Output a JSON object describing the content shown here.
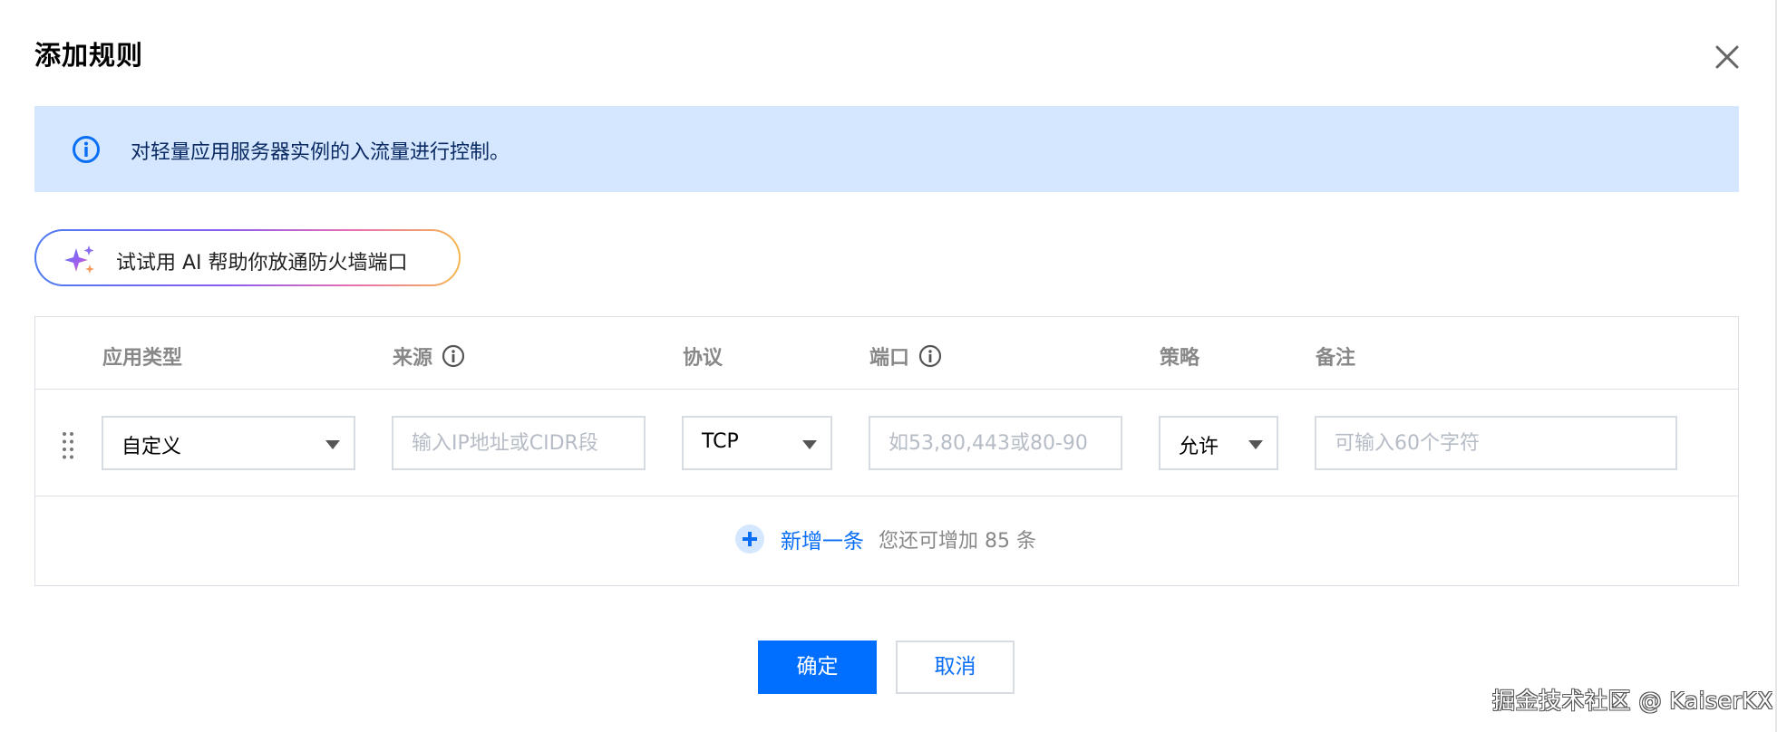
{
  "dialog": {
    "title": "添加规则",
    "close_icon": "close-icon"
  },
  "info": {
    "icon": "info-icon",
    "text": "对轻量应用服务器实例的入流量进行控制。"
  },
  "ai_button": {
    "icon": "sparkle-icon",
    "label": "试试用 AI 帮助你放通防火墙端口"
  },
  "table": {
    "headers": {
      "app_type": "应用类型",
      "source": "来源",
      "protocol": "协议",
      "port": "端口",
      "policy": "策略",
      "remark": "备注"
    },
    "row": {
      "app_type": "自定义",
      "source_placeholder": "输入IP地址或CIDR段",
      "protocol": "TCP",
      "port_placeholder": "如53,80,443或80-90",
      "policy": "允许",
      "remark_placeholder": "可输入60个字符"
    },
    "add_row": {
      "label": "新增一条",
      "remaining": "您还可增加 85 条"
    }
  },
  "footer": {
    "confirm": "确定",
    "cancel": "取消"
  },
  "watermark": "掘金技术社区 @ KaiserKX",
  "colors": {
    "primary": "#006eff",
    "link": "#0a6ff5",
    "info_bg": "#d5e7fe",
    "border": "#dcdfe5"
  }
}
